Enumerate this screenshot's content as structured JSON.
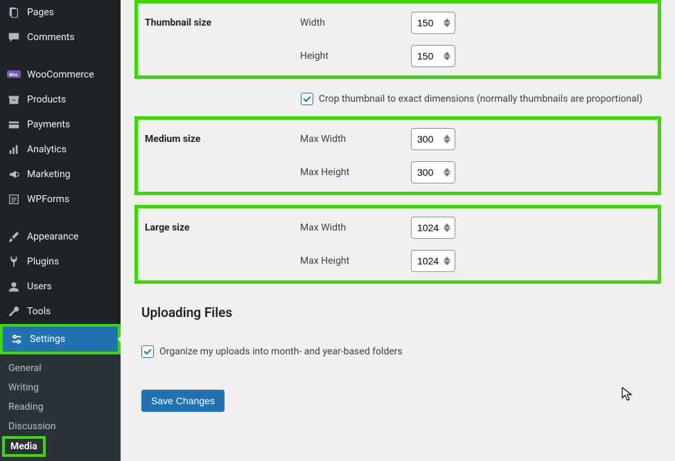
{
  "sidebar": {
    "items": [
      {
        "label": "Pages",
        "icon": "pages"
      },
      {
        "label": "Comments",
        "icon": "comment"
      },
      {
        "label": "WooCommerce",
        "icon": "woo"
      },
      {
        "label": "Products",
        "icon": "archive"
      },
      {
        "label": "Payments",
        "icon": "card"
      },
      {
        "label": "Analytics",
        "icon": "bars"
      },
      {
        "label": "Marketing",
        "icon": "megaphone"
      },
      {
        "label": "WPForms",
        "icon": "wpforms"
      },
      {
        "label": "Appearance",
        "icon": "brush"
      },
      {
        "label": "Plugins",
        "icon": "plug"
      },
      {
        "label": "Users",
        "icon": "user"
      },
      {
        "label": "Tools",
        "icon": "wrench"
      },
      {
        "label": "Settings",
        "icon": "sliders"
      }
    ],
    "submenu": [
      {
        "label": "General"
      },
      {
        "label": "Writing"
      },
      {
        "label": "Reading"
      },
      {
        "label": "Discussion"
      },
      {
        "label": "Media"
      }
    ]
  },
  "thumbnail": {
    "heading": "Thumbnail size",
    "width_label": "Width",
    "width_value": "150",
    "height_label": "Height",
    "height_value": "150"
  },
  "crop_label": "Crop thumbnail to exact dimensions (normally thumbnails are proportional)",
  "medium": {
    "heading": "Medium size",
    "width_label": "Max Width",
    "width_value": "300",
    "height_label": "Max Height",
    "height_value": "300"
  },
  "large": {
    "heading": "Large size",
    "width_label": "Max Width",
    "width_value": "1024",
    "height_label": "Max Height",
    "height_value": "1024"
  },
  "uploading_heading": "Uploading Files",
  "organize_label": "Organize my uploads into month- and year-based folders",
  "save_label": "Save Changes"
}
